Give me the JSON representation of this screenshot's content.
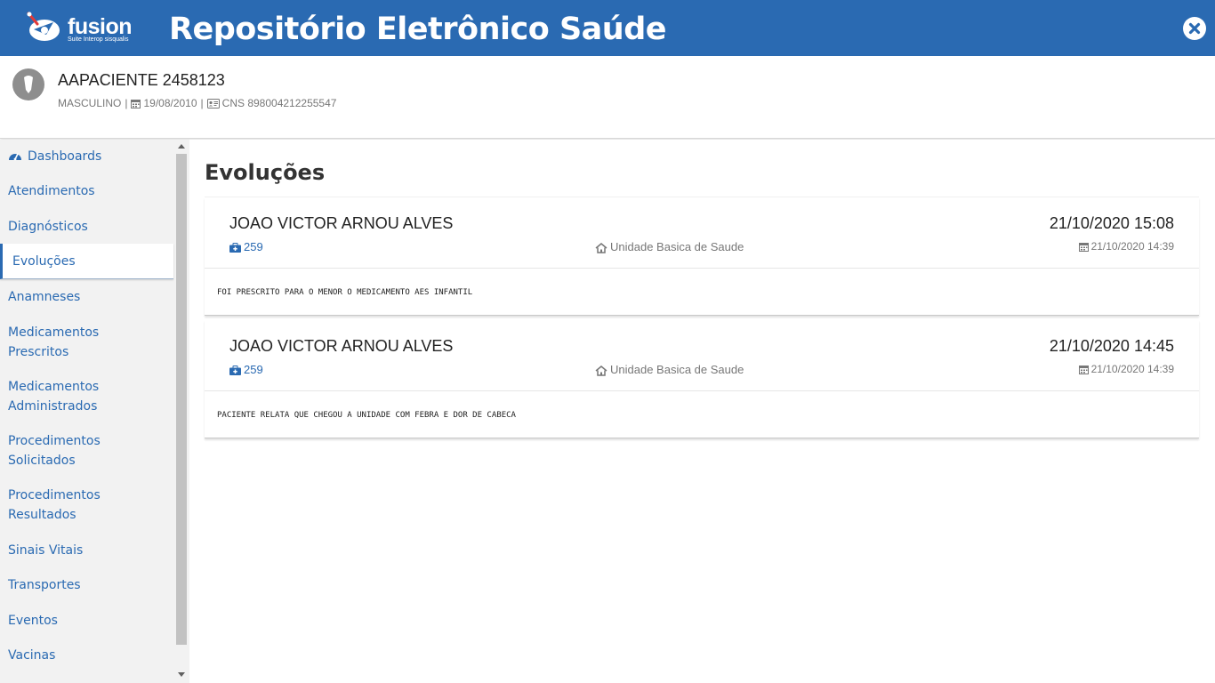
{
  "app": {
    "logo_text": "fusion",
    "logo_sub": "Suite Interop sisqualis",
    "title": "Repositório Eletrônico Saúde"
  },
  "patient": {
    "name": "AAPACIENTE 2458123",
    "sex": "MASCULINO",
    "birth_date": "19/08/2010",
    "cns": "CNS 898004212255547"
  },
  "sidebar": {
    "items": [
      {
        "label": "Dashboards"
      },
      {
        "label": "Atendimentos"
      },
      {
        "label": "Diagnósticos"
      },
      {
        "label": "Evoluções",
        "active": true
      },
      {
        "label": "Anamneses"
      },
      {
        "label": "Medicamentos",
        "label2": "Prescritos"
      },
      {
        "label": "Medicamentos",
        "label2": "Administrados"
      },
      {
        "label": "Procedimentos",
        "label2": "Solicitados"
      },
      {
        "label": "Procedimentos",
        "label2": "Resultados"
      },
      {
        "label": "Sinais Vitais"
      },
      {
        "label": "Transportes"
      },
      {
        "label": "Eventos"
      },
      {
        "label": "Vacinas"
      }
    ]
  },
  "main": {
    "title": "Evoluções",
    "cards": [
      {
        "professional": "JOAO VICTOR ARNOU ALVES",
        "datetime": "21/10/2020 15:08",
        "count": "259",
        "unit": "Unidade Basica de Saude",
        "record_date": "21/10/2020 14:39",
        "text": "FOI PRESCRITO PARA O MENOR O MEDICAMENTO AES INFANTIL"
      },
      {
        "professional": "JOAO VICTOR ARNOU ALVES",
        "datetime": "21/10/2020 14:45",
        "count": "259",
        "unit": "Unidade Basica de Saude",
        "record_date": "21/10/2020 14:39",
        "text": "PACIENTE RELATA QUE CHEGOU A UNIDADE COM FEBRA E DOR DE CABECA"
      }
    ]
  },
  "colors": {
    "brand": "#2a6ab2",
    "muted": "#777777",
    "sidebar_bg": "#f2f2f2"
  }
}
